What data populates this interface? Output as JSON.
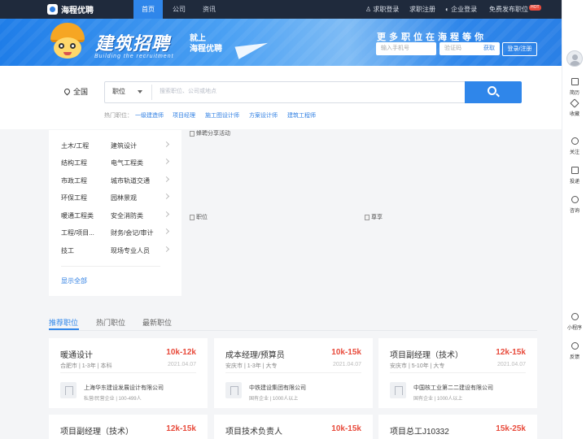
{
  "nav": {
    "logo_text": "海程优聘",
    "links": [
      "首页",
      "公司",
      "资讯"
    ],
    "right": {
      "seeker_login": "求职登录",
      "seeker_register": "求职注册",
      "company_login": "企业登录",
      "post_job": "免费发布职位",
      "badge": "HOT"
    }
  },
  "banner": {
    "title": "建筑招聘",
    "sub1": "就上",
    "sub2": "海程优聘",
    "english": "Building the recruitment",
    "slogan": "更多职位在海程等你",
    "phone_placeholder": "输入手机号",
    "code_placeholder": "验证码",
    "get_code": "获取",
    "login_button": "登录/注册"
  },
  "search": {
    "city": "全国",
    "type": "职位",
    "placeholder": "搜索职位、公司或地点",
    "hot_label": "热门职位：",
    "hot_links": [
      "一级建造师",
      "项目经理",
      "施工图设计师",
      "方案设计师",
      "建筑工程师"
    ]
  },
  "categories": {
    "items": [
      [
        "土木/工程",
        "建筑设计"
      ],
      [
        "结构工程",
        "电气工程类"
      ],
      [
        "市政工程",
        "城市轨道交通"
      ],
      [
        "环保工程",
        "园林景观"
      ],
      [
        "暖通工程类",
        "安全消防类"
      ],
      [
        "工程/项目...",
        "财务/会记/审计"
      ],
      [
        "技工",
        "现场专业人员"
      ]
    ],
    "show_all": "显示全部"
  },
  "promo": {
    "top": "蜂聘分享活动",
    "left": "职位",
    "right": "尊享"
  },
  "tabs": [
    "推荐职位",
    "热门职位",
    "最新职位"
  ],
  "jobs": [
    {
      "title": "暖通设计",
      "salary": "10k-12k",
      "meta": "合肥市  |  1-3年  |  本科",
      "date": "2021.04.07",
      "company": "上海华东建设发展设计有限公司",
      "company_meta": "私营/民营企业  |  100-499人"
    },
    {
      "title": "成本经理/预算员",
      "salary": "10k-15k",
      "meta": "安庆市  |  1-3年  |  大专",
      "date": "2021.04.07",
      "company": "中铁建设集团有限公司",
      "company_meta": "国有企业  |  1000人以上"
    },
    {
      "title": "项目副经理（技术）",
      "salary": "12k-15k",
      "meta": "安庆市  |  5-10年  |  大专",
      "date": "2021.04.07",
      "company": "中国核工业第二二建设有限公司",
      "company_meta": "国有企业  |  1000人以上"
    },
    {
      "title": "项目副经理（技术）",
      "salary": "12k-15k"
    },
    {
      "title": "项目技术负责人",
      "salary": "10k-15k"
    },
    {
      "title": "项目总工J10332",
      "salary": "15k-25k"
    }
  ],
  "sidebar": {
    "items": [
      "简历",
      "收藏",
      "关注",
      "投递",
      "咨询",
      "小程序",
      "反馈"
    ]
  },
  "colors": {
    "primary": "#2f86ea",
    "nav_bg": "#1f2a3c",
    "salary": "#e84b3c"
  }
}
